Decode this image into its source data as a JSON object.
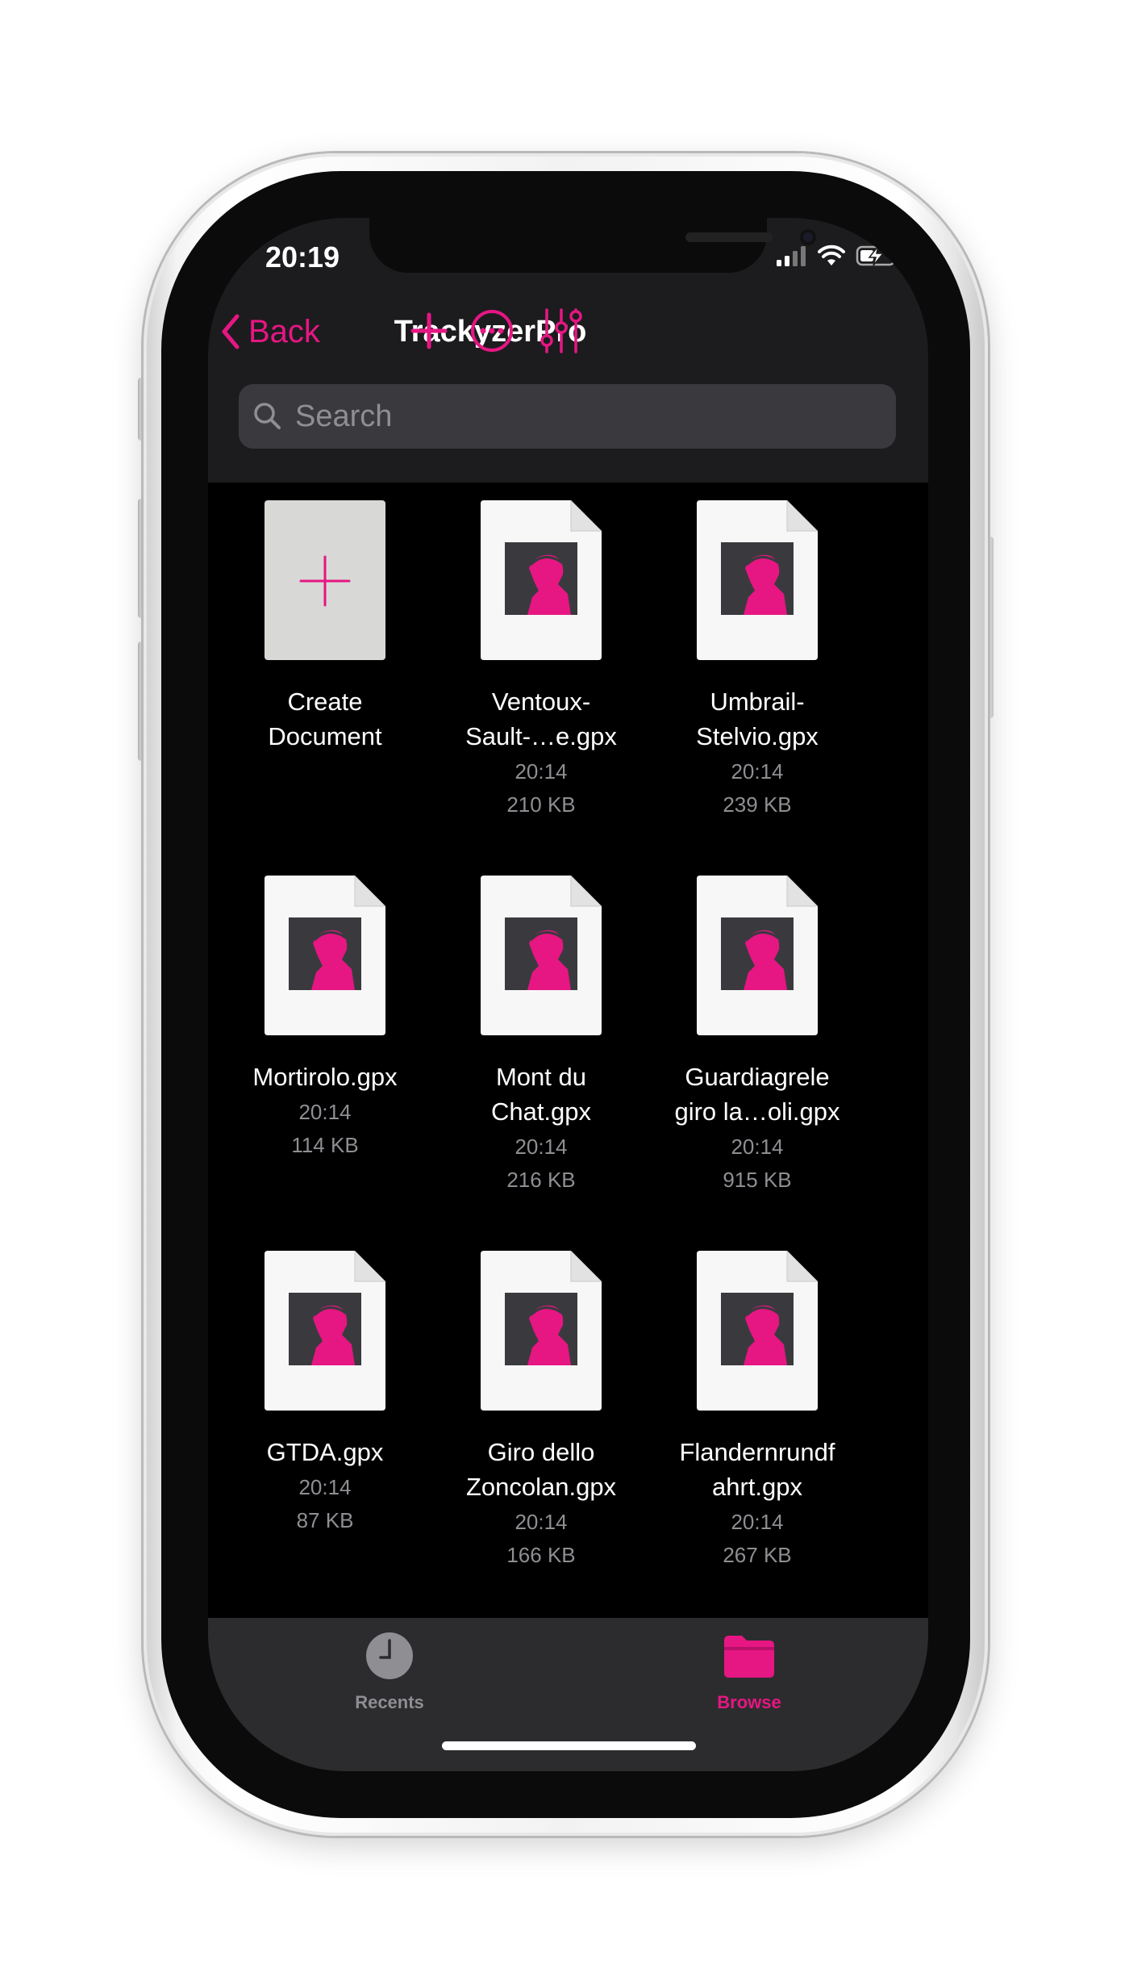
{
  "colors": {
    "accent": "#e61683",
    "background": "#000000",
    "header_background": "#1c1c1e",
    "tab_bar_background": "#2c2c2e",
    "secondary_text": "#8e8e93"
  },
  "status_bar": {
    "time": "20:19",
    "icons": [
      "signal-icon",
      "wifi-icon",
      "battery-charging-icon"
    ]
  },
  "nav": {
    "back_label": "Back",
    "title": "TrackyzerPro",
    "actions": [
      "add-icon",
      "more-icon",
      "sliders-icon"
    ]
  },
  "search": {
    "placeholder": "Search"
  },
  "files": [
    {
      "type": "create",
      "name": "Create\nDocument"
    },
    {
      "type": "gpx",
      "name": "Ventoux-\nSault-…e.gpx",
      "time": "20:14",
      "size": "210 KB"
    },
    {
      "type": "gpx",
      "name": "Umbrail-\nStelvio.gpx",
      "time": "20:14",
      "size": "239 KB"
    },
    {
      "type": "gpx",
      "name": "Mortirolo.gpx",
      "time": "20:14",
      "size": "114 KB"
    },
    {
      "type": "gpx",
      "name": "Mont du\nChat.gpx",
      "time": "20:14",
      "size": "216 KB"
    },
    {
      "type": "gpx",
      "name": "Guardiagrele\ngiro la…oli.gpx",
      "time": "20:14",
      "size": "915 KB"
    },
    {
      "type": "gpx",
      "name": "GTDA.gpx",
      "time": "20:14",
      "size": "87 KB"
    },
    {
      "type": "gpx",
      "name": "Giro dello\nZoncolan.gpx",
      "time": "20:14",
      "size": "166 KB"
    },
    {
      "type": "gpx",
      "name": "Flandernrundf\nahrt.gpx",
      "time": "20:14",
      "size": "267 KB"
    }
  ],
  "tabs": [
    {
      "label": "Recents",
      "icon": "clock-icon",
      "selected": false
    },
    {
      "label": "Browse",
      "icon": "folder-icon",
      "selected": true
    }
  ]
}
